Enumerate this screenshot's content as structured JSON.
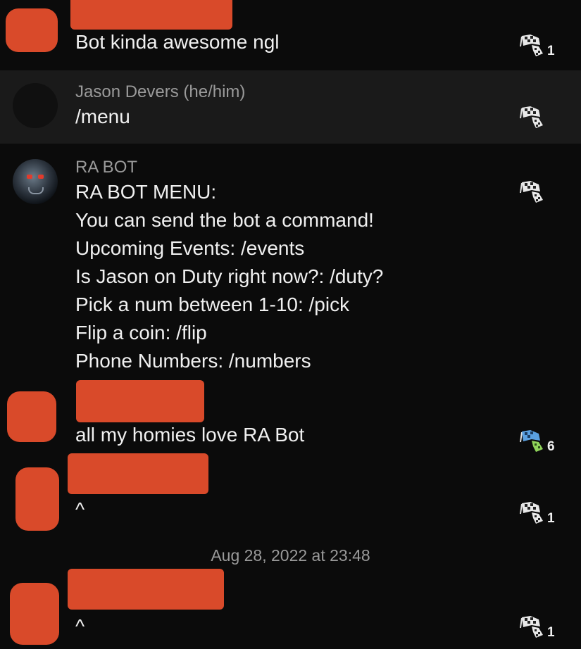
{
  "messages": [
    {
      "author": "",
      "text": "Bot kinda awesome ngl",
      "reaction_count": "1"
    },
    {
      "author": "Jason Devers (he/him)",
      "text": "/menu",
      "reaction_count": ""
    },
    {
      "author": "RA BOT",
      "lines": [
        "RA BOT MENU:",
        "You can send the bot a command!",
        "Upcoming Events: /events",
        "Is Jason on Duty right now?: /duty?",
        "Pick a num between 1-10: /pick",
        "Flip a coin: /flip",
        "Phone Numbers: /numbers"
      ],
      "reaction_count": ""
    },
    {
      "author": "",
      "text": "all my homies love RA Bot",
      "reaction_count": "6"
    },
    {
      "author": "",
      "text": "^",
      "reaction_count": "1"
    },
    {
      "author": "",
      "text": "^",
      "reaction_count": "1"
    }
  ],
  "date_divider": "Aug 28, 2022 at 23:48",
  "icons": {
    "reaction": "checkered-flag-icon"
  },
  "colors": {
    "redaction": "#d94a2a",
    "background": "#0b0b0b",
    "highlight_row": "#1a1a1a",
    "reaction_active": "#5aa0e0"
  }
}
